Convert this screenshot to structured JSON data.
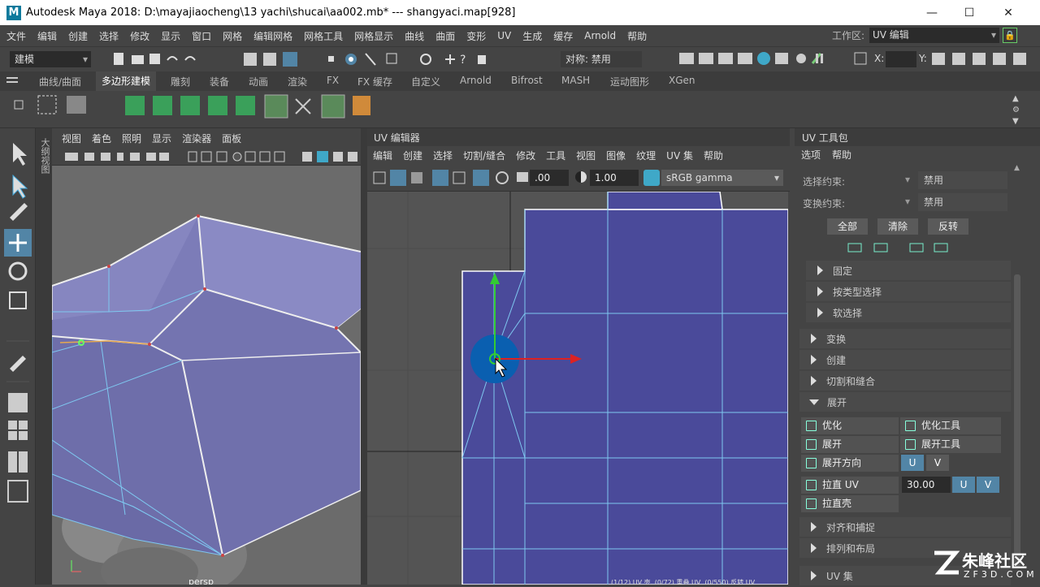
{
  "window": {
    "title": "Autodesk Maya 2018: D:\\mayajiaocheng\\13 yachi\\shucai\\aa002.mb*   ---   shangyaci.map[928]",
    "logo": "M"
  },
  "menubar": {
    "items": [
      "文件",
      "编辑",
      "创建",
      "选择",
      "修改",
      "显示",
      "窗口",
      "网格",
      "编辑网格",
      "网格工具",
      "网格显示",
      "曲线",
      "曲面",
      "变形",
      "UV",
      "生成",
      "缓存",
      "Arnold",
      "帮助"
    ],
    "workspace_label": "工作区:",
    "workspace_value": "UV 编辑"
  },
  "statusline": {
    "mode": "建模",
    "symmetry": "对称: 禁用",
    "x_label": "X:",
    "y_label": "Y:"
  },
  "shelf": {
    "tabs": [
      "曲线/曲面",
      "多边形建模",
      "雕刻",
      "装备",
      "动画",
      "渲染",
      "FX",
      "FX 缓存",
      "自定义",
      "Arnold",
      "Bifrost",
      "MASH",
      "运动图形",
      "XGen"
    ],
    "active_tab": "多边形建模"
  },
  "viewport": {
    "side_label": "大纲视图",
    "menu": [
      "视图",
      "着色",
      "照明",
      "显示",
      "渲染器",
      "面板"
    ],
    "camera_label": "persp"
  },
  "uv_editor": {
    "title": "UV 编辑器",
    "menu": [
      "编辑",
      "创建",
      "选择",
      "切割/缝合",
      "修改",
      "工具",
      "视图",
      "图像",
      "纹理",
      "UV 集",
      "帮助"
    ],
    "field_a": ".00",
    "field_b": "1.00",
    "color_space": "sRGB gamma",
    "footer_text": "(1/12) UV 壳, (0/72) 重叠 UV, (0/550) 反转 UV"
  },
  "uv_toolkit": {
    "title": "UV 工具包",
    "menu": [
      "选项",
      "帮助"
    ],
    "select_constraint_label": "选择约束:",
    "select_constraint_value": "禁用",
    "transform_constraint_label": "变换约束:",
    "transform_constraint_value": "禁用",
    "buttons": {
      "all": "全部",
      "clear": "清除",
      "invert": "反转"
    },
    "subsections": [
      "固定",
      "按类型选择",
      "软选择"
    ],
    "sections_collapsed": [
      "变换",
      "创建",
      "切割和缝合"
    ],
    "section_open": "展开",
    "unfold_rows": {
      "optimize": "优化",
      "optimize_tool": "优化工具",
      "unfold": "展开",
      "unfold_tool": "展开工具",
      "unfold_dir": "展开方向",
      "straighten_uv": "拉直 UV",
      "straighten_shell": "拉直壳",
      "u": "U",
      "v": "V",
      "angle": "30.00"
    },
    "sections_bottom": [
      "对齐和捕捉",
      "排列和布局"
    ],
    "uvset_section": "UV 集"
  },
  "watermark": {
    "brand": "朱峰社区",
    "url": "ZF3D.COM"
  },
  "colors": {
    "uv_shell": "#4a4a9a",
    "uv_edge": "#7ec8f0",
    "mesh_face": "#7c7cb8",
    "selection": "#0a5fb0"
  }
}
